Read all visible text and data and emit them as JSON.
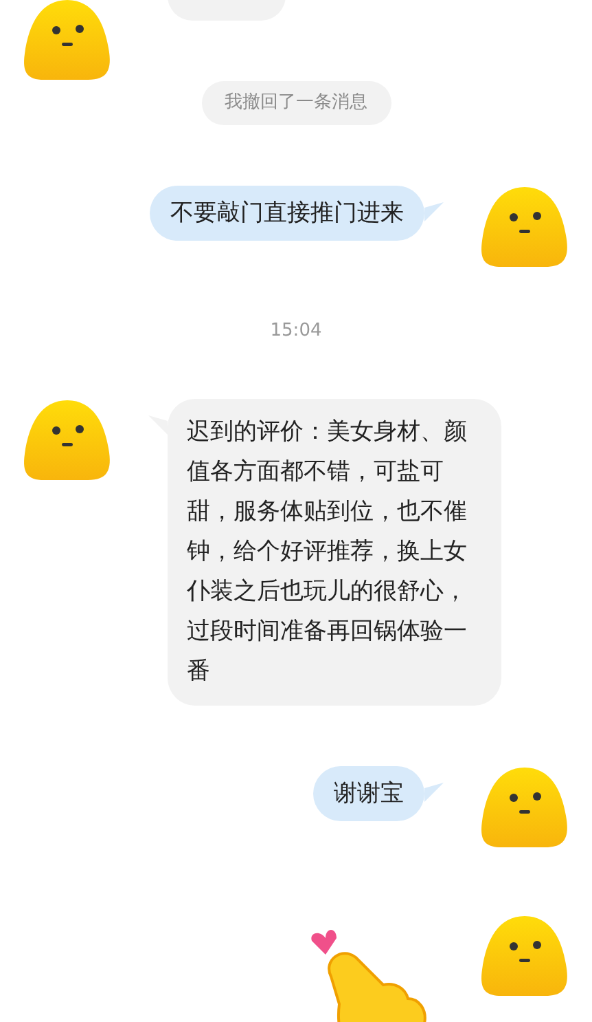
{
  "messages": [
    {
      "kind": "incoming_cut"
    },
    {
      "kind": "notice",
      "text": "我撤回了一条消息"
    },
    {
      "kind": "outgoing",
      "text": "不要敲门直接推门进来"
    },
    {
      "kind": "time",
      "text": "15:04"
    },
    {
      "kind": "incoming",
      "text": "迟到的评价：美女身材、颜值各方面都不错，可盐可甜，服务体贴到位，也不催钟，给个好评推荐，换上女仆装之后也玩儿的很舒心，过段时间准备再回锅体验一番"
    },
    {
      "kind": "outgoing",
      "text": "谢谢宝"
    },
    {
      "kind": "outgoing_sticker"
    }
  ]
}
